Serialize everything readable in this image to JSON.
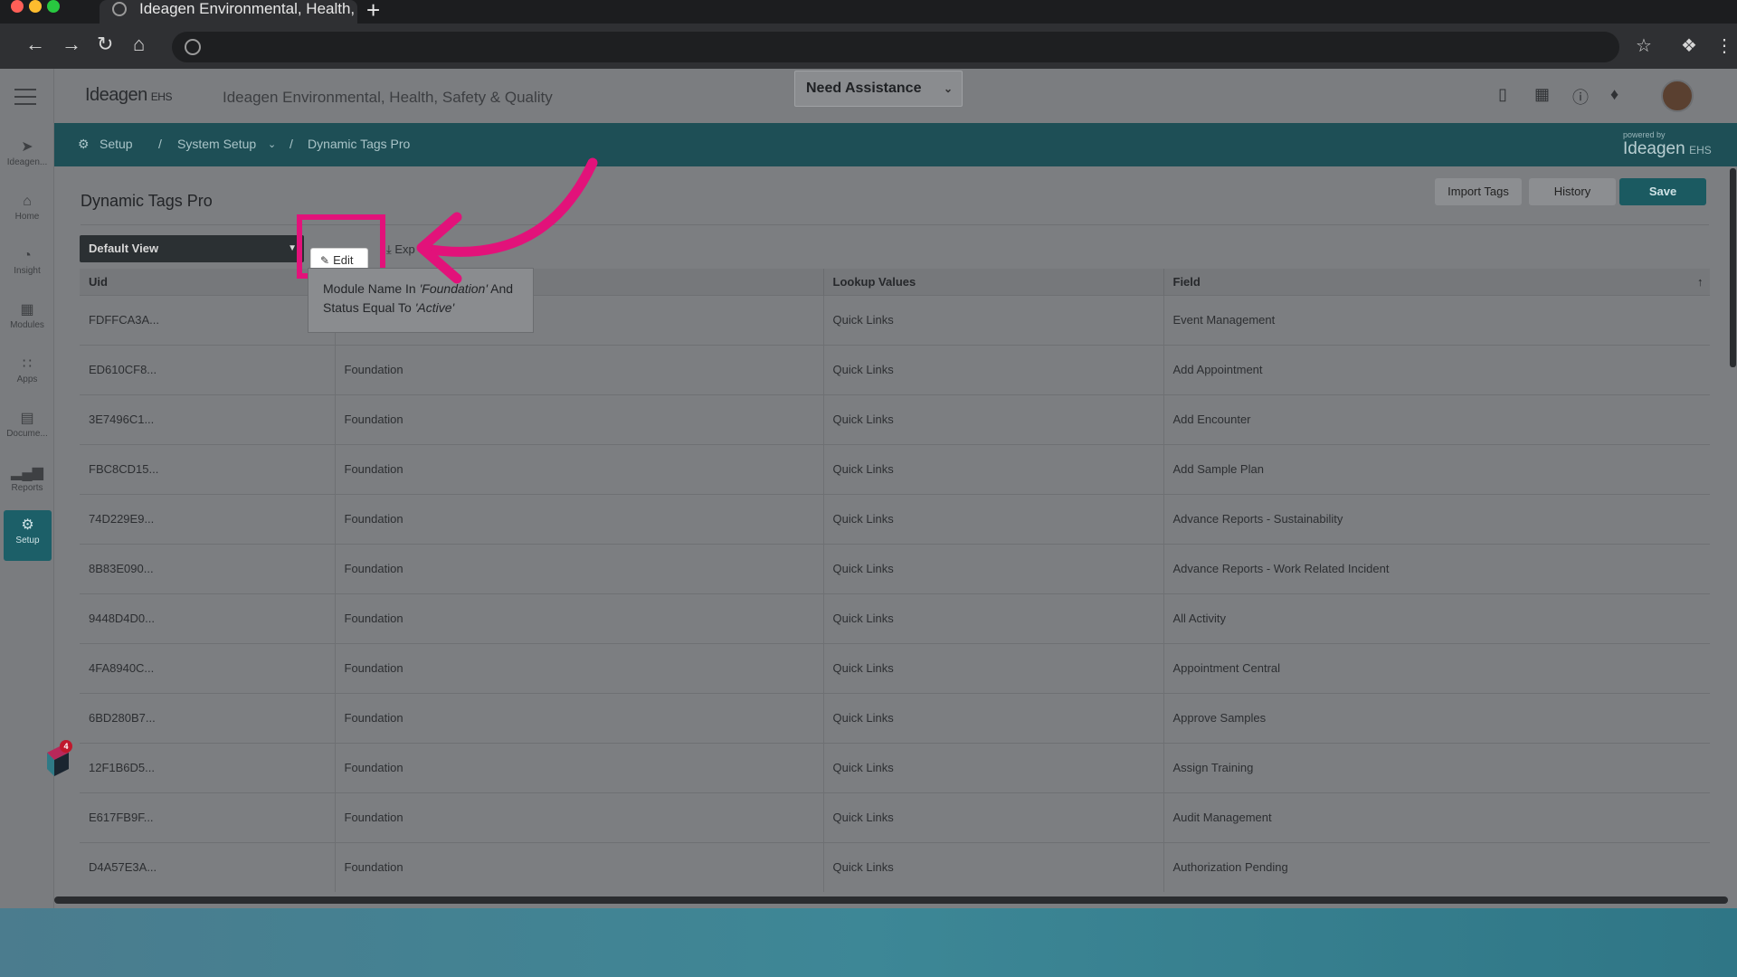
{
  "browser": {
    "tab_title": "Ideagen Environmental, Health, S",
    "new_tab": "+"
  },
  "app": {
    "logo": "Ideagen",
    "logo_suffix": "EHS",
    "title": "Ideagen Environmental, Health, Safety & Quality",
    "assistance": "Need Assistance",
    "powered_by": "powered by",
    "powered_brand": "Ideagen",
    "powered_suffix": "EHS"
  },
  "rail": [
    {
      "label": "Ideagen...",
      "icon": "rocket-icon"
    },
    {
      "label": "Home",
      "icon": "home-icon"
    },
    {
      "label": "Insight",
      "icon": "insight-icon"
    },
    {
      "label": "Modules",
      "icon": "grid-icon"
    },
    {
      "label": "Apps",
      "icon": "apps-icon"
    },
    {
      "label": "Docume...",
      "icon": "document-icon"
    },
    {
      "label": "Reports",
      "icon": "chart-icon"
    },
    {
      "label": "Setup",
      "icon": "gear-icon"
    }
  ],
  "breadcrumb": {
    "setup": "Setup",
    "separator": "/",
    "system_setup": "System Setup",
    "current": "Dynamic Tags Pro"
  },
  "page": {
    "title": "Dynamic Tags Pro",
    "import_tags": "Import Tags",
    "history": "History",
    "save": "Save",
    "view": "Default View",
    "edit": "Edit",
    "export": "Exp"
  },
  "tooltip": {
    "line1_prefix": "Module Name In ",
    "line1_value": "'Foundation'",
    "line1_suffix": " And",
    "line2_prefix": "Status Equal To ",
    "line2_value": "'Active'"
  },
  "table": {
    "headers": [
      "Uid",
      "",
      "Lookup Values",
      "Field"
    ],
    "rows": [
      [
        "FDFFCA3A...",
        "",
        "Quick Links",
        "Event Management"
      ],
      [
        "ED610CF8...",
        "Foundation",
        "Quick Links",
        "Add Appointment"
      ],
      [
        "3E7496C1...",
        "Foundation",
        "Quick Links",
        "Add Encounter"
      ],
      [
        "FBC8CD15...",
        "Foundation",
        "Quick Links",
        "Add Sample Plan"
      ],
      [
        "74D229E9...",
        "Foundation",
        "Quick Links",
        "Advance Reports - Sustainability"
      ],
      [
        "8B83E090...",
        "Foundation",
        "Quick Links",
        "Advance Reports - Work Related Incident"
      ],
      [
        "9448D4D0...",
        "Foundation",
        "Quick Links",
        "All Activity"
      ],
      [
        "4FA8940C...",
        "Foundation",
        "Quick Links",
        "Appointment Central"
      ],
      [
        "6BD280B7...",
        "Foundation",
        "Quick Links",
        "Approve Samples"
      ],
      [
        "12F1B6D5...",
        "Foundation",
        "Quick Links",
        "Assign Training"
      ],
      [
        "E617FB9F...",
        "Foundation",
        "Quick Links",
        "Audit Management"
      ],
      [
        "D4A57E3A...",
        "Foundation",
        "Quick Links",
        "Authorization Pending"
      ]
    ]
  },
  "fab_badge": "4",
  "colors": {
    "highlight": "#e2127a",
    "accent": "#1b5a61",
    "breadbar": "#1e4f56"
  }
}
